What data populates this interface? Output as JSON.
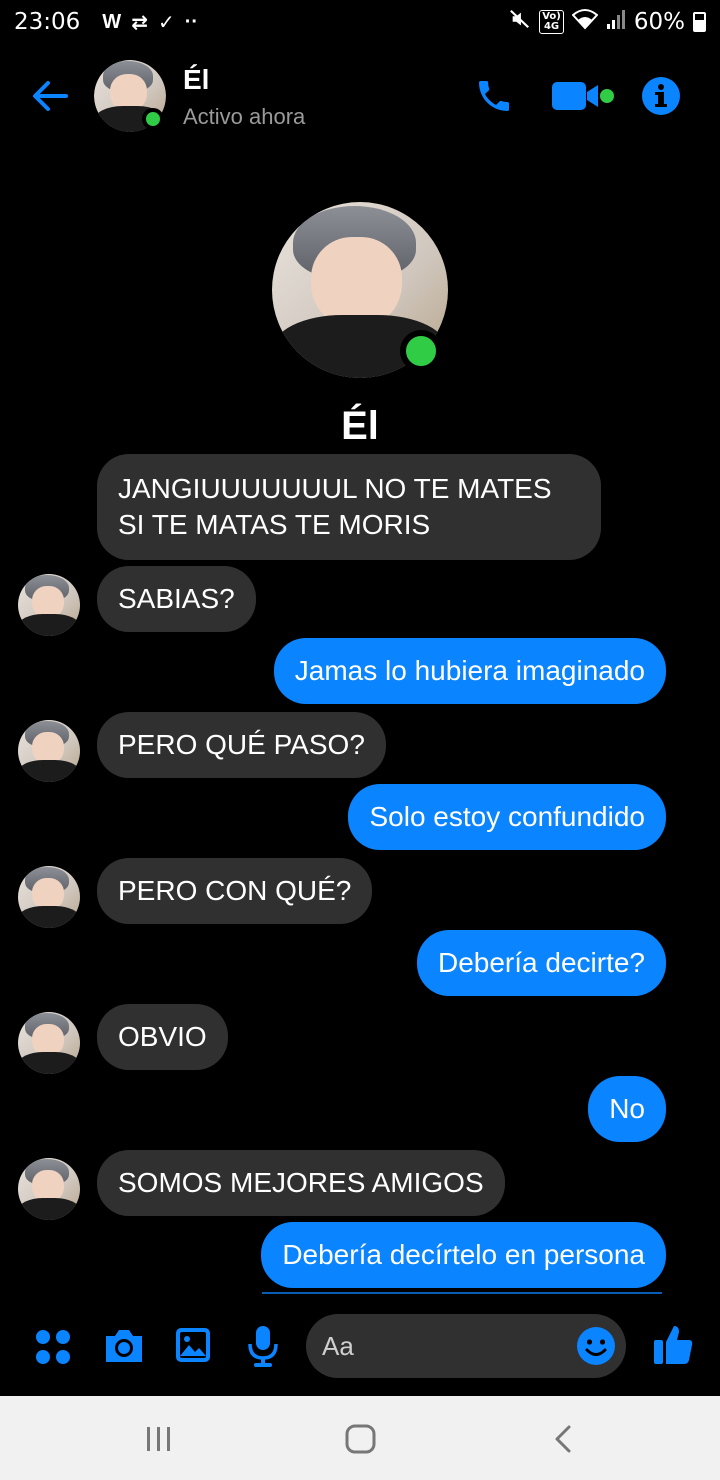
{
  "status_bar": {
    "time": "23:06",
    "left_icons": [
      "w-icon",
      "retweet-icon",
      "download-check-icon",
      "more-dots-icon"
    ],
    "volte_text": "Vo) 4G",
    "battery": "60%"
  },
  "header": {
    "name": "Él",
    "status": "Activo ahora"
  },
  "profile": {
    "name": "Él"
  },
  "messages": [
    {
      "side": "in",
      "text": "JANGIUUUUUUUL NO TE MATES\nSI TE MATAS TE MORIS",
      "avatar": false
    },
    {
      "side": "in",
      "text": "SABIAS?",
      "avatar": true
    },
    {
      "side": "out",
      "text": "Jamas lo hubiera imaginado"
    },
    {
      "side": "in",
      "text": "PERO QUÉ PASO?",
      "avatar": true
    },
    {
      "side": "out",
      "text": "Solo estoy confundido"
    },
    {
      "side": "in",
      "text": "PERO CON QUÉ?",
      "avatar": true
    },
    {
      "side": "out",
      "text": "Debería decirte?"
    },
    {
      "side": "in",
      "text": "OBVIO",
      "avatar": true
    },
    {
      "side": "out",
      "text": "No"
    },
    {
      "side": "in",
      "text": "SOMOS MEJORES AMIGOS",
      "avatar": true
    },
    {
      "side": "out",
      "text": "Debería decírtelo en persona"
    }
  ],
  "composer": {
    "placeholder": "Aa"
  },
  "colors": {
    "accent": "#0a84ff",
    "online": "#31cc46",
    "incoming_bubble": "#303030",
    "background": "#000000"
  }
}
